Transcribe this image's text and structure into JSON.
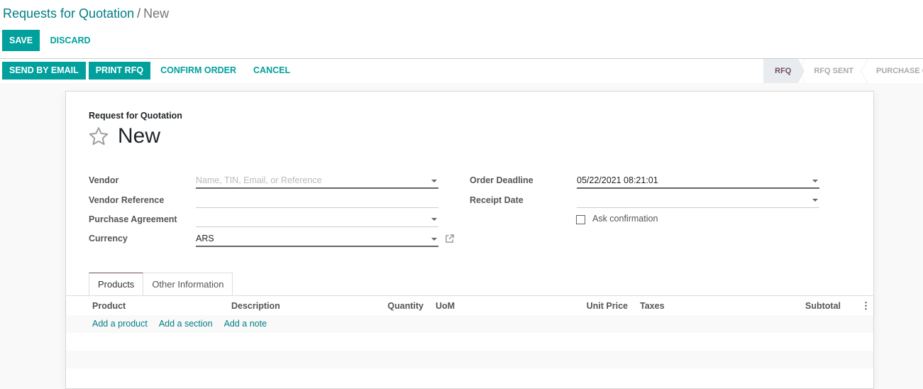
{
  "breadcrumb": {
    "parent": "Requests for Quotation",
    "separator": "/",
    "current": "New"
  },
  "edit_buttons": {
    "save": "SAVE",
    "discard": "DISCARD"
  },
  "status_actions": {
    "send_by_email": "SEND BY EMAIL",
    "print_rfq": "PRINT RFQ",
    "confirm_order": "CONFIRM ORDER",
    "cancel": "CANCEL"
  },
  "stages": [
    {
      "label": "RFQ",
      "active": true
    },
    {
      "label": "RFQ SENT",
      "active": false
    },
    {
      "label": "PURCHASE ORDER",
      "active": false
    }
  ],
  "sheet": {
    "doc_kind": "Request for Quotation",
    "title": "New",
    "star_icon": "star-outline-icon"
  },
  "left_fields": {
    "vendor": {
      "label": "Vendor",
      "value": "",
      "placeholder": "Name, TIN, Email, or Reference"
    },
    "vendor_reference": {
      "label": "Vendor Reference",
      "value": ""
    },
    "purchase_agreement": {
      "label": "Purchase Agreement",
      "value": ""
    },
    "currency": {
      "label": "Currency",
      "value": "ARS"
    }
  },
  "right_fields": {
    "order_deadline": {
      "label": "Order Deadline",
      "value": "05/22/2021 08:21:01"
    },
    "receipt_date": {
      "label": "Receipt Date",
      "value": ""
    },
    "ask_confirmation": {
      "label": "Ask confirmation",
      "checked": false
    }
  },
  "tabs": [
    {
      "label": "Products",
      "active": true
    },
    {
      "label": "Other Information",
      "active": false
    }
  ],
  "table": {
    "columns": [
      "Product",
      "Description",
      "Quantity",
      "UoM",
      "Unit Price",
      "Taxes",
      "Subtotal"
    ],
    "add_links": [
      "Add a product",
      "Add a section",
      "Add a note"
    ]
  },
  "colors": {
    "primary": "#00a09d",
    "link": "#017e84",
    "active_stage": "#714b67"
  }
}
